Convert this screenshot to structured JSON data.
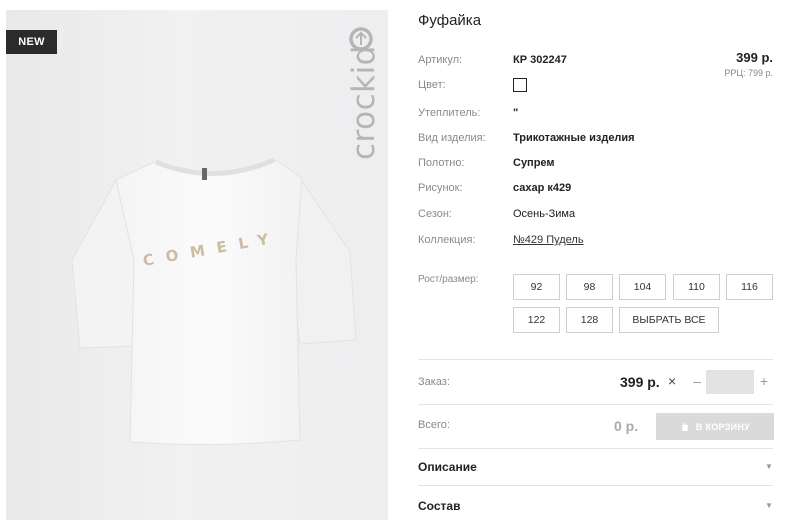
{
  "image": {
    "badge": "NEW",
    "brand": "crockid",
    "print_text": "COMELY"
  },
  "product": {
    "title": "Фуфайка",
    "price": "399 р.",
    "rrp": "РРЦ: 799 р."
  },
  "props": [
    {
      "label": "Артикул:",
      "value": "КР 302247"
    },
    {
      "label": "Цвет:",
      "value": ""
    },
    {
      "label": "Утеплитель:",
      "value": "\""
    },
    {
      "label": "Вид изделия:",
      "value": "Трикотажные изделия"
    },
    {
      "label": "Полотно:",
      "value": "Супрем"
    },
    {
      "label": "Рисунок:",
      "value": "сахар к429"
    },
    {
      "label": "Сезон:",
      "value": "Осень-Зима"
    },
    {
      "label": "Коллекция:",
      "value": "№429 Пудель"
    }
  ],
  "sizes": {
    "label": "Рост/размер:",
    "options": [
      "92",
      "98",
      "104",
      "110",
      "116",
      "122",
      "128"
    ],
    "select_all": "ВЫБРАТЬ ВСЕ"
  },
  "order": {
    "label": "Заказ:",
    "price": "399 р.",
    "times": "×",
    "minus": "–",
    "plus": "+",
    "quantity": ""
  },
  "total": {
    "label": "Всего:",
    "value": "0 р.",
    "cart_button": "В КОРЗИНУ"
  },
  "accordion": [
    {
      "title": "Описание"
    },
    {
      "title": "Состав"
    }
  ],
  "colors": {
    "badge_bg": "#2b2b2b",
    "cart_button_bg": "#dadada",
    "qty_input_bg": "#e3e3e3"
  }
}
